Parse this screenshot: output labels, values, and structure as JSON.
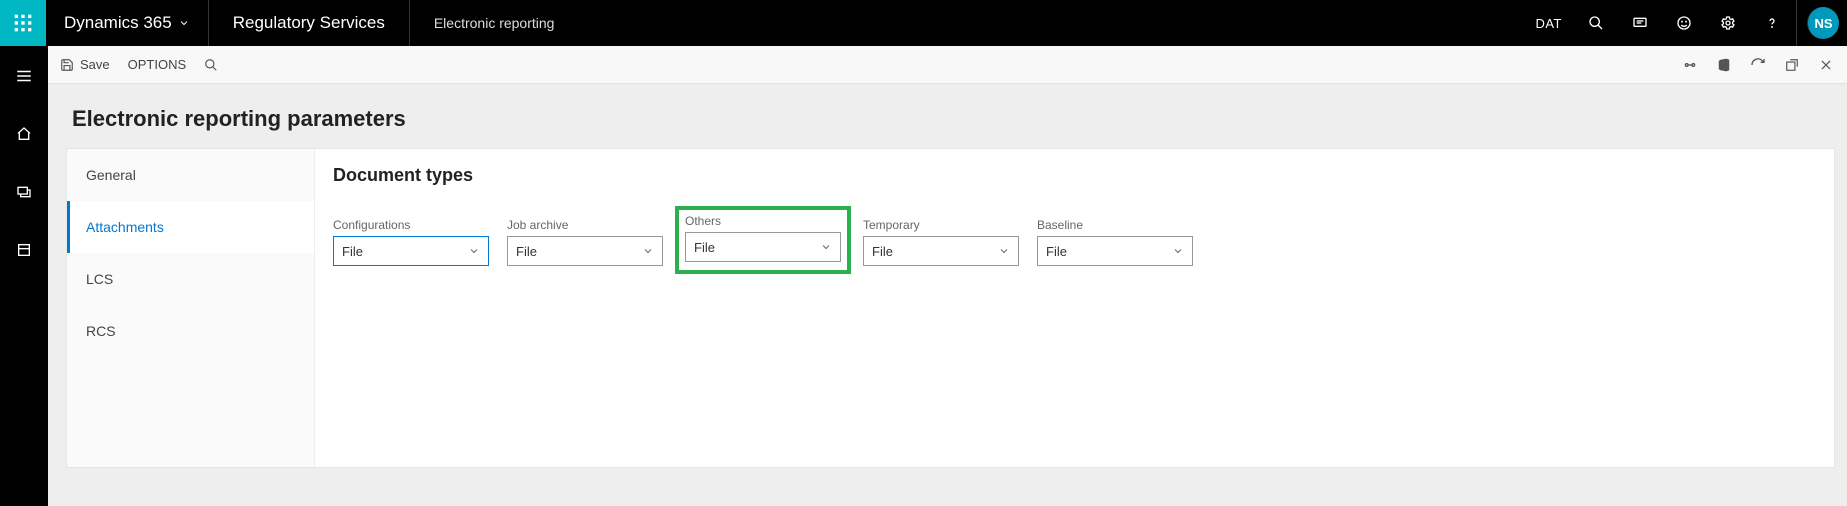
{
  "topbar": {
    "brand": "Dynamics 365",
    "module": "Regulatory Services",
    "area": "Electronic reporting",
    "company": "DAT",
    "avatar": "NS"
  },
  "actionbar": {
    "save": "Save",
    "options": "OPTIONS"
  },
  "page": {
    "title": "Electronic reporting parameters"
  },
  "tabs": {
    "general": "General",
    "attachments": "Attachments",
    "lcs": "LCS",
    "rcs": "RCS"
  },
  "section": {
    "title": "Document types"
  },
  "fields": {
    "configurations": {
      "label": "Configurations",
      "value": "File"
    },
    "job_archive": {
      "label": "Job archive",
      "value": "File"
    },
    "others": {
      "label": "Others",
      "value": "File"
    },
    "temporary": {
      "label": "Temporary",
      "value": "File"
    },
    "baseline": {
      "label": "Baseline",
      "value": "File"
    }
  }
}
